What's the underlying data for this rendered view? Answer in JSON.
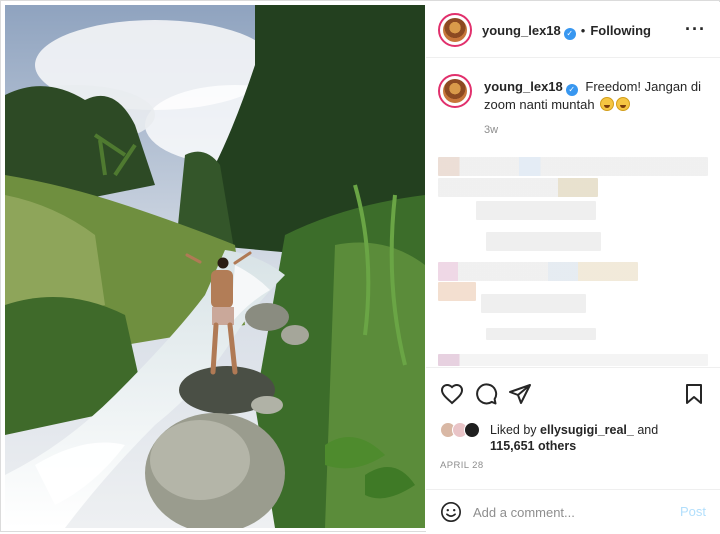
{
  "post": {
    "username": "young_lex18",
    "follow_status": "Following",
    "caption": "Freedom! Jangan di zoom nanti muntah",
    "caption_emojis": [
      "rolling-on-floor-laughing-emoji",
      "rolling-on-floor-laughing-emoji"
    ],
    "time_ago": "3w",
    "liked_by_prefix": "Liked by",
    "liked_by_user": "ellysugigi_real_",
    "liked_by_connector": "and",
    "others_count": "115,651 others",
    "date": "APRIL 28"
  },
  "comment": {
    "placeholder": "Add a comment...",
    "post_label": "Post"
  },
  "icons": {
    "verified": "verified-badge-icon",
    "more": "more-options-icon",
    "like": "heart-icon",
    "comment": "comment-icon",
    "share": "send-icon",
    "save": "bookmark-icon",
    "emoji": "smiley-icon"
  },
  "colors": {
    "verified": "#3897f0",
    "post_button_disabled": "#b2dffc",
    "secondary_text": "#8e8e8e",
    "avatar_ring": "#e1306c"
  }
}
